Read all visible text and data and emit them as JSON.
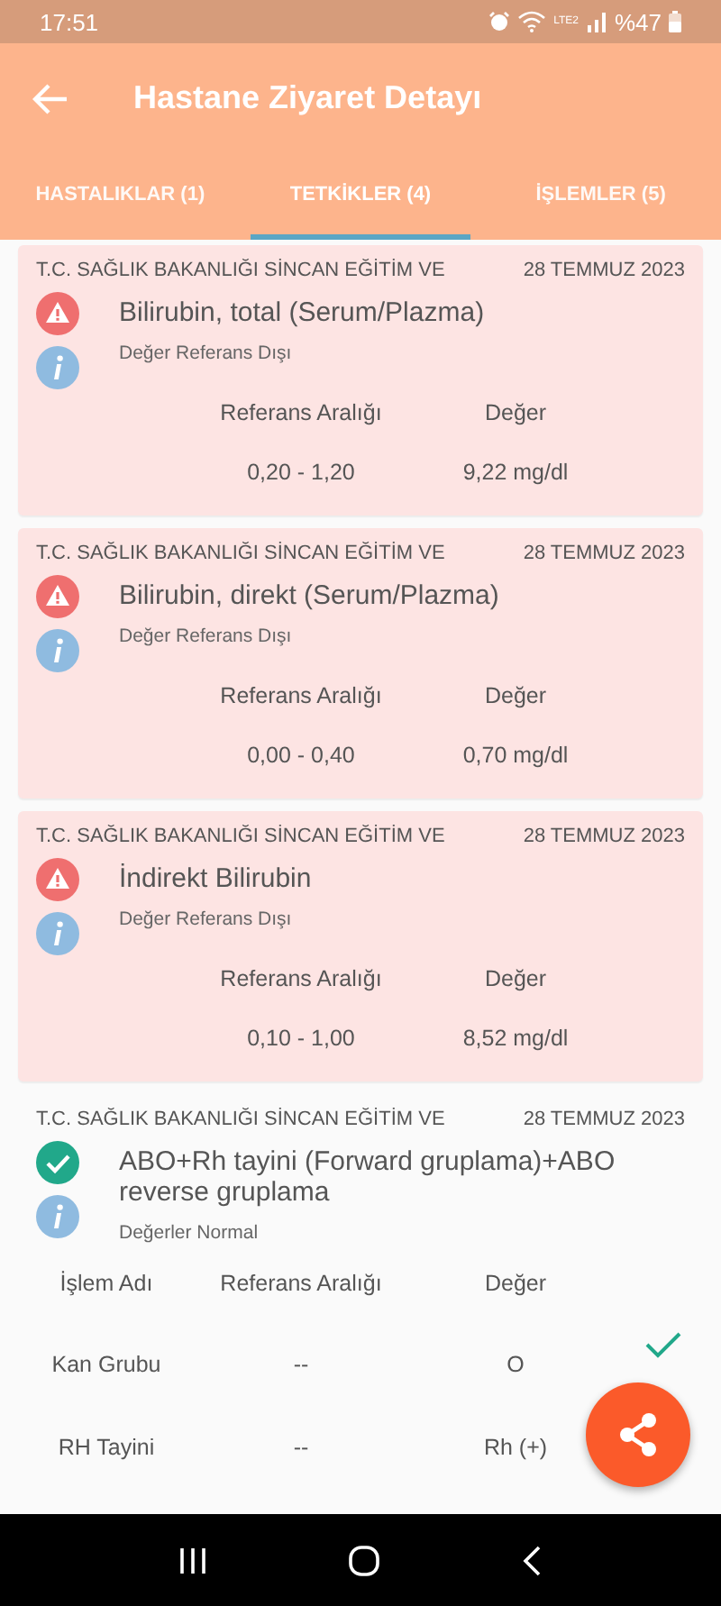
{
  "status_bar": {
    "time": "17:51",
    "network": "LTE2",
    "battery": "%47"
  },
  "app_bar": {
    "title": "Hastane Ziyaret Detayı"
  },
  "tabs": [
    {
      "label": "HASTALIKLAR (1)",
      "selected": false
    },
    {
      "label": "TETKİKLER (4)",
      "selected": true
    },
    {
      "label": "İŞLEMLER (5)",
      "selected": false
    }
  ],
  "tests": [
    {
      "kind": "abnormal",
      "hospital": "T.C. SAĞLIK BAKANLIĞI SİNCAN EĞİTİM VE",
      "date": "28 TEMMUZ 2023",
      "name": "Bilirubin, total (Serum/Plazma)",
      "status": "Değer Referans Dışı",
      "columns": [
        "Referans Aralığı",
        "Değer"
      ],
      "rows": [
        {
          "cells": [
            "0,20 - 1,20",
            "9,22 mg/dl"
          ]
        }
      ]
    },
    {
      "kind": "abnormal",
      "hospital": "T.C. SAĞLIK BAKANLIĞI SİNCAN EĞİTİM VE",
      "date": "28 TEMMUZ 2023",
      "name": "Bilirubin, direkt (Serum/Plazma)",
      "status": "Değer Referans Dışı",
      "columns": [
        "Referans Aralığı",
        "Değer"
      ],
      "rows": [
        {
          "cells": [
            "0,00 - 0,40",
            "0,70 mg/dl"
          ]
        }
      ]
    },
    {
      "kind": "abnormal",
      "hospital": "T.C. SAĞLIK BAKANLIĞI SİNCAN EĞİTİM VE",
      "date": "28 TEMMUZ 2023",
      "name": "İndirekt Bilirubin",
      "status": "Değer Referans Dışı",
      "columns": [
        "Referans Aralığı",
        "Değer"
      ],
      "rows": [
        {
          "cells": [
            "0,10 - 1,00",
            "8,52 mg/dl"
          ]
        }
      ]
    },
    {
      "kind": "normal",
      "hospital": "T.C. SAĞLIK BAKANLIĞI SİNCAN EĞİTİM VE",
      "date": "28 TEMMUZ 2023",
      "name": "ABO+Rh tayini   (Forward gruplama)+ABO reverse gruplama",
      "status": "Değerler Normal",
      "columns": [
        "İşlem Adı",
        "Referans Aralığı",
        "Değer"
      ],
      "rows": [
        {
          "cells": [
            "Kan Grubu",
            "--",
            "O"
          ],
          "checked": true
        },
        {
          "cells": [
            "RH Tayini",
            "--",
            "Rh (+)"
          ],
          "checked": false
        }
      ]
    }
  ]
}
